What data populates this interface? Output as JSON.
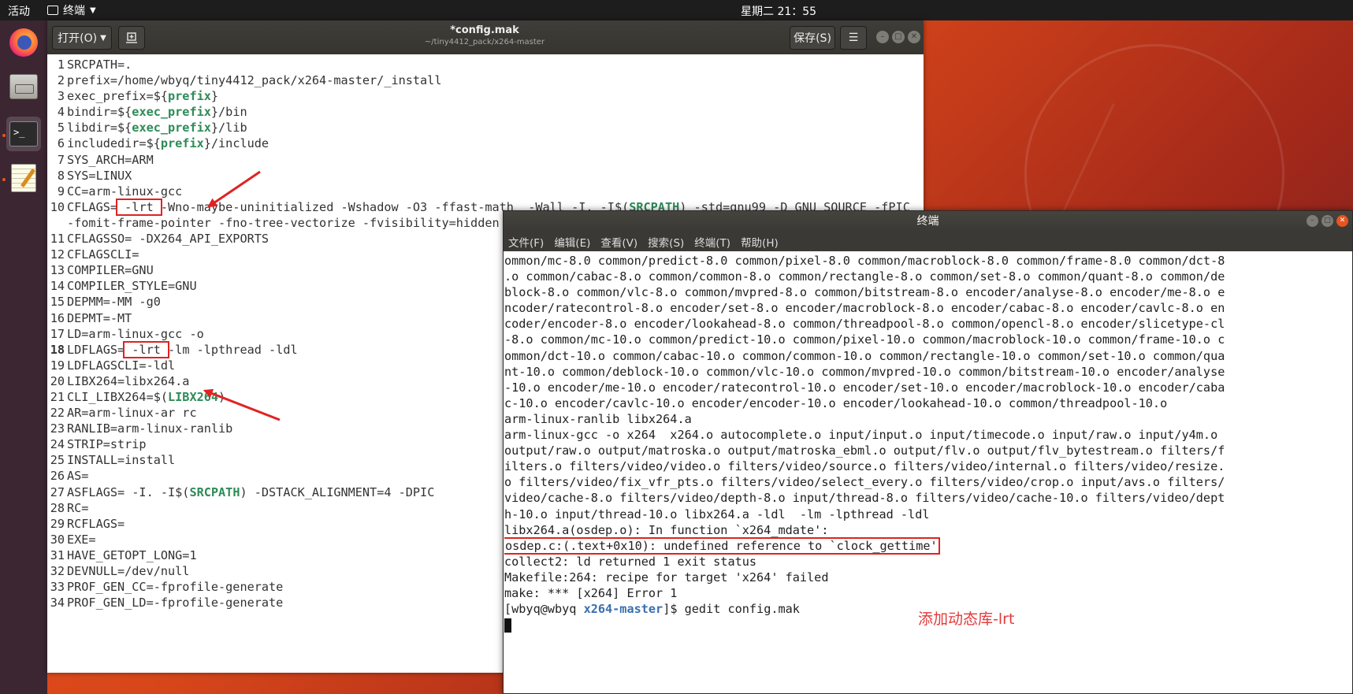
{
  "topbar": {
    "activities": "活动",
    "app_name": "终端",
    "clock": "星期二 21：55"
  },
  "dock": {
    "items": [
      "firefox-icon",
      "files-icon",
      "terminal-icon",
      "text-editor-icon"
    ]
  },
  "gedit": {
    "open_label": "打开(O)",
    "save_label": "保存(S)",
    "title": "*config.mak",
    "subtitle": "~/tiny4412_pack/x264-master",
    "lines": [
      {
        "n": "1",
        "pre": "SRCPATH=.",
        "kw": "",
        "post": ""
      },
      {
        "n": "2",
        "pre": "prefix=/home/wbyq/tiny4412_pack/x264-master/_install",
        "kw": "",
        "post": ""
      },
      {
        "n": "3",
        "pre": "exec_prefix=${",
        "kw": "prefix",
        "post": "}"
      },
      {
        "n": "4",
        "pre": "bindir=${",
        "kw": "exec_prefix",
        "post": "}/bin"
      },
      {
        "n": "5",
        "pre": "libdir=${",
        "kw": "exec_prefix",
        "post": "}/lib"
      },
      {
        "n": "6",
        "pre": "includedir=${",
        "kw": "prefix",
        "post": "}/include"
      },
      {
        "n": "7",
        "pre": "SYS_ARCH=ARM",
        "kw": "",
        "post": ""
      },
      {
        "n": "8",
        "pre": "SYS=LINUX",
        "kw": "",
        "post": ""
      },
      {
        "n": "9",
        "pre": "CC=arm-linux-gcc",
        "kw": "",
        "post": ""
      }
    ],
    "line10": {
      "n": "10",
      "pre": "CFLAGS=",
      "boxed": " -lrt ",
      "mid": "-Wno-maybe-uninitialized -Wshadow -O3 -ffast-math  -Wall -I. -I$(",
      "kw": "SRCPATH",
      "post": ") -std=gnu99 -D_GNU_SOURCE -fPIC",
      "cont": "-fomit-frame-pointer -fno-tree-vectorize -fvisibility=hidden"
    },
    "lines_b": [
      {
        "n": "11",
        "pre": "CFLAGSSO= -DX264_API_EXPORTS",
        "kw": "",
        "post": ""
      },
      {
        "n": "12",
        "pre": "CFLAGSCLI=",
        "kw": "",
        "post": ""
      },
      {
        "n": "13",
        "pre": "COMPILER=GNU",
        "kw": "",
        "post": ""
      },
      {
        "n": "14",
        "pre": "COMPILER_STYLE=GNU",
        "kw": "",
        "post": ""
      },
      {
        "n": "15",
        "pre": "DEPMM=-MM -g0",
        "kw": "",
        "post": ""
      },
      {
        "n": "16",
        "pre": "DEPMT=-MT",
        "kw": "",
        "post": ""
      },
      {
        "n": "17",
        "pre": "LD=arm-linux-gcc -o",
        "kw": "",
        "post": ""
      }
    ],
    "line18": {
      "n": "18",
      "pre": "LDFLAGS=",
      "boxed": " -lrt ",
      "post": "-lm -lpthread -ldl"
    },
    "lines_c": [
      {
        "n": "19",
        "pre": "LDFLAGSCLI=-ldl",
        "kw": "",
        "post": ""
      },
      {
        "n": "20",
        "pre": "LIBX264=libx264.a",
        "kw": "",
        "post": ""
      },
      {
        "n": "21",
        "pre": "CLI_LIBX264=$(",
        "kw": "LIBX264",
        "post": ")"
      },
      {
        "n": "22",
        "pre": "AR=arm-linux-ar rc",
        "kw": "",
        "post": ""
      },
      {
        "n": "23",
        "pre": "RANLIB=arm-linux-ranlib",
        "kw": "",
        "post": ""
      },
      {
        "n": "24",
        "pre": "STRIP=strip",
        "kw": "",
        "post": ""
      },
      {
        "n": "25",
        "pre": "INSTALL=install",
        "kw": "",
        "post": ""
      },
      {
        "n": "26",
        "pre": "AS=",
        "kw": "",
        "post": ""
      },
      {
        "n": "27",
        "pre": "ASFLAGS= -I. -I$(",
        "kw": "SRCPATH",
        "post": ") -DSTACK_ALIGNMENT=4 -DPIC"
      },
      {
        "n": "28",
        "pre": "RC=",
        "kw": "",
        "post": ""
      },
      {
        "n": "29",
        "pre": "RCFLAGS=",
        "kw": "",
        "post": ""
      },
      {
        "n": "30",
        "pre": "EXE=",
        "kw": "",
        "post": ""
      },
      {
        "n": "31",
        "pre": "HAVE_GETOPT_LONG=1",
        "kw": "",
        "post": ""
      },
      {
        "n": "32",
        "pre": "DEVNULL=/dev/null",
        "kw": "",
        "post": ""
      },
      {
        "n": "33",
        "pre": "PROF_GEN_CC=-fprofile-generate",
        "kw": "",
        "post": ""
      },
      {
        "n": "34",
        "pre": "PROF_GEN_LD=-fprofile-generate",
        "kw": "",
        "post": ""
      }
    ]
  },
  "terminal": {
    "title": "终端",
    "menu": [
      "文件(F)",
      "编辑(E)",
      "查看(V)",
      "搜索(S)",
      "终端(T)",
      "帮助(H)"
    ],
    "lines_top": [
      "ommon/mc-8.0 common/predict-8.0 common/pixel-8.0 common/macroblock-8.0 common/frame-8.0 common/dct-8",
      ".o common/cabac-8.o common/common-8.o common/rectangle-8.o common/set-8.o common/quant-8.o common/de",
      "block-8.o common/vlc-8.o common/mvpred-8.o common/bitstream-8.o encoder/analyse-8.o encoder/me-8.o e",
      "ncoder/ratecontrol-8.o encoder/set-8.o encoder/macroblock-8.o encoder/cabac-8.o encoder/cavlc-8.o en",
      "coder/encoder-8.o encoder/lookahead-8.o common/threadpool-8.o common/opencl-8.o encoder/slicetype-cl",
      "-8.o common/mc-10.o common/predict-10.o common/pixel-10.o common/macroblock-10.o common/frame-10.o c",
      "ommon/dct-10.o common/cabac-10.o common/common-10.o common/rectangle-10.o common/set-10.o common/qua",
      "nt-10.o common/deblock-10.o common/vlc-10.o common/mvpred-10.o common/bitstream-10.o encoder/analyse",
      "-10.o encoder/me-10.o encoder/ratecontrol-10.o encoder/set-10.o encoder/macroblock-10.o encoder/caba",
      "c-10.o encoder/cavlc-10.o encoder/encoder-10.o encoder/lookahead-10.o common/threadpool-10.o",
      "arm-linux-ranlib libx264.a",
      "arm-linux-gcc -o x264  x264.o autocomplete.o input/input.o input/timecode.o input/raw.o input/y4m.o",
      "output/raw.o output/matroska.o output/matroska_ebml.o output/flv.o output/flv_bytestream.o filters/f",
      "ilters.o filters/video/video.o filters/video/source.o filters/video/internal.o filters/video/resize.",
      "o filters/video/fix_vfr_pts.o filters/video/select_every.o filters/video/crop.o input/avs.o filters/",
      "video/cache-8.o filters/video/depth-8.o input/thread-8.o filters/video/cache-10.o filters/video/dept",
      "h-10.o input/thread-10.o libx264.a -ldl  -lm -lpthread -ldl",
      "libx264.a(osdep.o): In function `x264_mdate':"
    ],
    "error_line": "osdep.c:(.text+0x10): undefined reference to `clock_gettime'",
    "lines_bottom": [
      "collect2: ld returned 1 exit status",
      "Makefile:264: recipe for target 'x264' failed",
      "make: *** [x264] Error 1"
    ],
    "prompt_user": "[wbyq@wbyq ",
    "prompt_path": "x264-master",
    "prompt_cmd": "]$ gedit config.mak",
    "annotation": "添加动态库-lrt"
  }
}
